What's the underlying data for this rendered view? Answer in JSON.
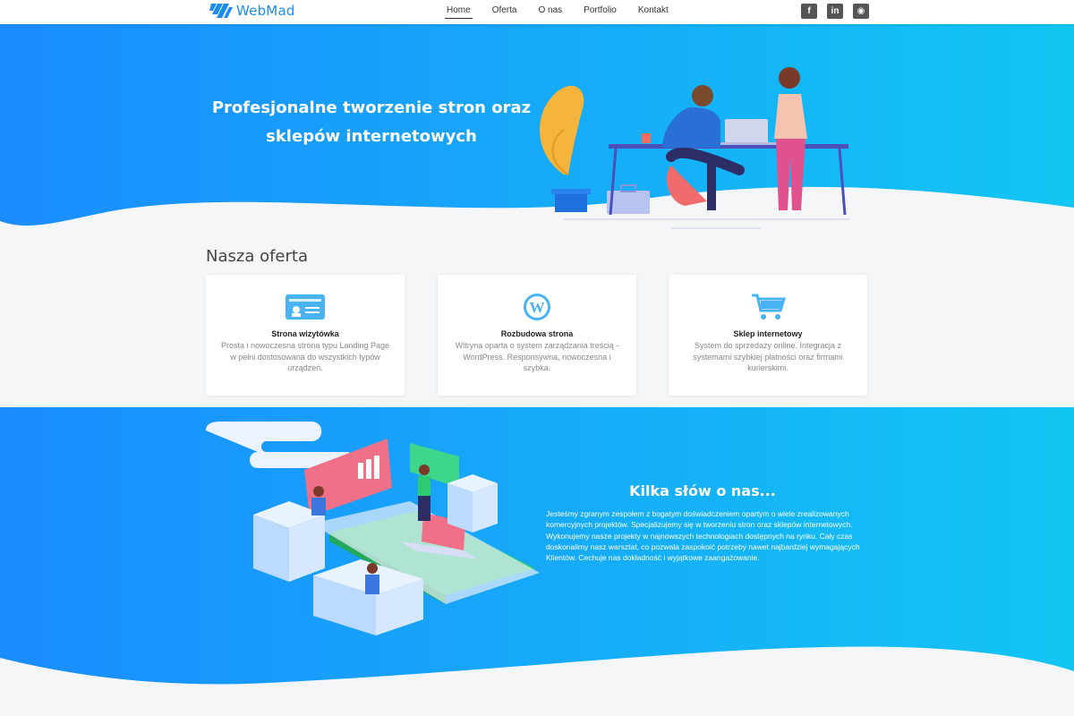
{
  "brand": {
    "name": "WebMad",
    "color": "#1d8cf0"
  },
  "nav": {
    "items": [
      {
        "label": "Home",
        "active": true
      },
      {
        "label": "Oferta",
        "active": false
      },
      {
        "label": "O nas",
        "active": false
      },
      {
        "label": "Portfolio",
        "active": false
      },
      {
        "label": "Kontakt",
        "active": false
      }
    ],
    "social": [
      {
        "icon": "facebook-icon",
        "glyph": "f"
      },
      {
        "icon": "linkedin-icon",
        "glyph": "in"
      },
      {
        "icon": "github-icon",
        "glyph": "◉"
      }
    ]
  },
  "hero": {
    "title": "Profesjonalne tworzenie stron oraz sklepów internetowych",
    "gradient": [
      "#1a8cff",
      "#12c6f3"
    ]
  },
  "offer": {
    "title": "Nasza oferta",
    "cards": [
      {
        "icon": "id-card-icon",
        "title": "Strona wizytówka",
        "description": "Prosta i nowoczesna strona typu Landing Page w pełni dostosowana do wszystkich typów urządzeń."
      },
      {
        "icon": "wordpress-icon",
        "title": "Rozbudowa strona",
        "description": "Witryna oparta o system zarządzania treścią - WordPress. Responsywna, nowoczesna i szybka."
      },
      {
        "icon": "shopping-cart-icon",
        "title": "Sklep internetowy",
        "description": "System do sprzedaży online. Integracja z systemami szybkiej płatności oraz firmami kurierskimi."
      }
    ]
  },
  "about": {
    "title": "Kilka słów o nas...",
    "text": "Jesteśmy zgranym zespołem z bogatym doświadczeniem opartym o wiele zrealizowanych komercyjnych projektów. Specjalizujemy się w tworzeniu stron oraz sklepów internetowych. Wykonujemy nasze projekty w najnowszych technologiach dostępnych na rynku. Cały czas doskonalimy nasz warsztat, co pozwala zaspokoić potrzeby nawet najbardziej wymagających Klientów. Cechuje nas dokładność i wyjątkowe zaangażowanie."
  }
}
